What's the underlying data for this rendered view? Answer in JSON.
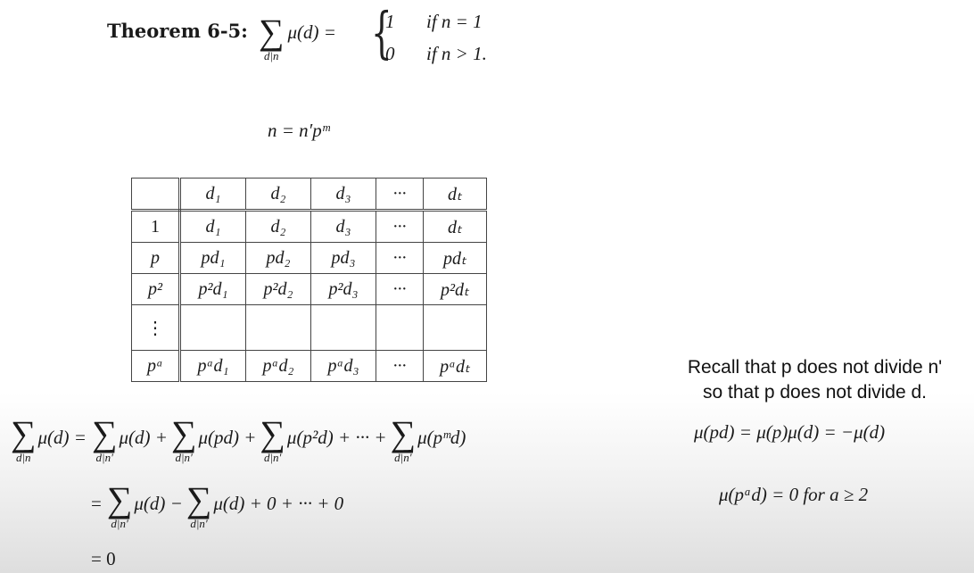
{
  "theorem": {
    "label": "Theorem 6-5:",
    "sum_symbol": "∑",
    "sum_index": "d|n",
    "lhs": "μ(d) =",
    "cases": [
      {
        "value": "1",
        "condition": "if n = 1"
      },
      {
        "value": "0",
        "condition": "if n > 1."
      }
    ]
  },
  "factorization": "n = n′pᵐ",
  "table": {
    "header": [
      "",
      "d₁",
      "d₂",
      "d₃",
      "···",
      "dₜ"
    ],
    "rows": [
      [
        "1",
        "d₁",
        "d₂",
        "d₃",
        "···",
        "dₜ"
      ],
      [
        "p",
        "pd₁",
        "pd₂",
        "pd₃",
        "···",
        "pdₜ"
      ],
      [
        "p²",
        "p²d₁",
        "p²d₂",
        "p²d₃",
        "···",
        "p²dₜ"
      ],
      [
        "⋮",
        "",
        "",
        "",
        "",
        ""
      ],
      [
        "pᵃ",
        "pᵃd₁",
        "pᵃd₂",
        "pᵃd₃",
        "···",
        "pᵃdₜ"
      ]
    ]
  },
  "derivation": {
    "line1": {
      "lhs_index": "d|n",
      "lhs": "μ(d) =",
      "terms": [
        {
          "index": "d|n′",
          "body": "μ(d) +"
        },
        {
          "index": "d|n′",
          "body": "μ(pd) +"
        },
        {
          "index": "d|n′",
          "body": "μ(p²d) + ··· +"
        },
        {
          "index": "d|n′",
          "body": "μ(pᵐd)"
        }
      ]
    },
    "line2": {
      "prefix": "=",
      "terms": [
        {
          "index": "d|n′",
          "body": "μ(d) −"
        },
        {
          "index": "d|n′",
          "body": "μ(d) + 0 + ··· + 0"
        }
      ]
    },
    "line3": "= 0"
  },
  "notes": {
    "recall_line1": "Recall that p does not divide n'",
    "recall_line2": "so that p does not divide d.",
    "mu_pd": "μ(pd) = μ(p)μ(d) = −μ(d)",
    "mu_pad": "μ(pᵃd) = 0 for a ≥ 2"
  }
}
